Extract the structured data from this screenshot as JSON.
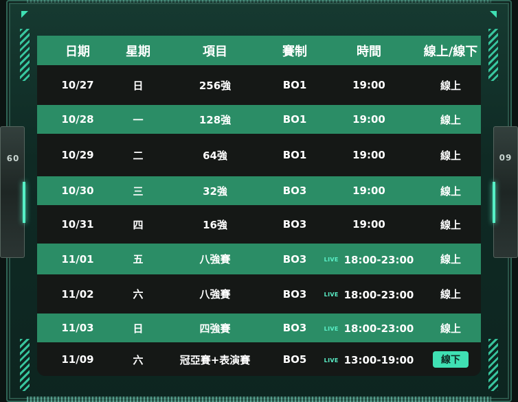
{
  "side_badge": "09",
  "headers": [
    "日期",
    "星期",
    "項目",
    "賽制",
    "時間",
    "線上/線下"
  ],
  "live_label": "LIVE",
  "rows": [
    {
      "date": "10/27",
      "weekday": "日",
      "stage": "256強",
      "format": "BO1",
      "time": "19:00",
      "live": false,
      "mode": "線上",
      "mode_highlight": false
    },
    {
      "date": "10/28",
      "weekday": "一",
      "stage": "128強",
      "format": "BO1",
      "time": "19:00",
      "live": false,
      "mode": "線上",
      "mode_highlight": false
    },
    {
      "date": "10/29",
      "weekday": "二",
      "stage": "64強",
      "format": "BO1",
      "time": "19:00",
      "live": false,
      "mode": "線上",
      "mode_highlight": false
    },
    {
      "date": "10/30",
      "weekday": "三",
      "stage": "32強",
      "format": "BO3",
      "time": "19:00",
      "live": false,
      "mode": "線上",
      "mode_highlight": false
    },
    {
      "date": "10/31",
      "weekday": "四",
      "stage": "16強",
      "format": "BO3",
      "time": "19:00",
      "live": false,
      "mode": "線上",
      "mode_highlight": false
    },
    {
      "date": "11/01",
      "weekday": "五",
      "stage": "八強賽",
      "format": "BO3",
      "time": "18:00-23:00",
      "live": true,
      "mode": "線上",
      "mode_highlight": false
    },
    {
      "date": "11/02",
      "weekday": "六",
      "stage": "八強賽",
      "format": "BO3",
      "time": "18:00-23:00",
      "live": true,
      "mode": "線上",
      "mode_highlight": false
    },
    {
      "date": "11/03",
      "weekday": "日",
      "stage": "四強賽",
      "format": "BO3",
      "time": "18:00-23:00",
      "live": true,
      "mode": "線上",
      "mode_highlight": false
    },
    {
      "date": "11/09",
      "weekday": "六",
      "stage": "冠亞賽+表演賽",
      "format": "BO5",
      "time": "13:00-19:00",
      "live": true,
      "mode": "線下",
      "mode_highlight": true
    }
  ],
  "colors": {
    "accent": "#3fe0b3",
    "row_green": "#2b8d66",
    "row_dark": "#151816",
    "frame": "#163a31"
  }
}
